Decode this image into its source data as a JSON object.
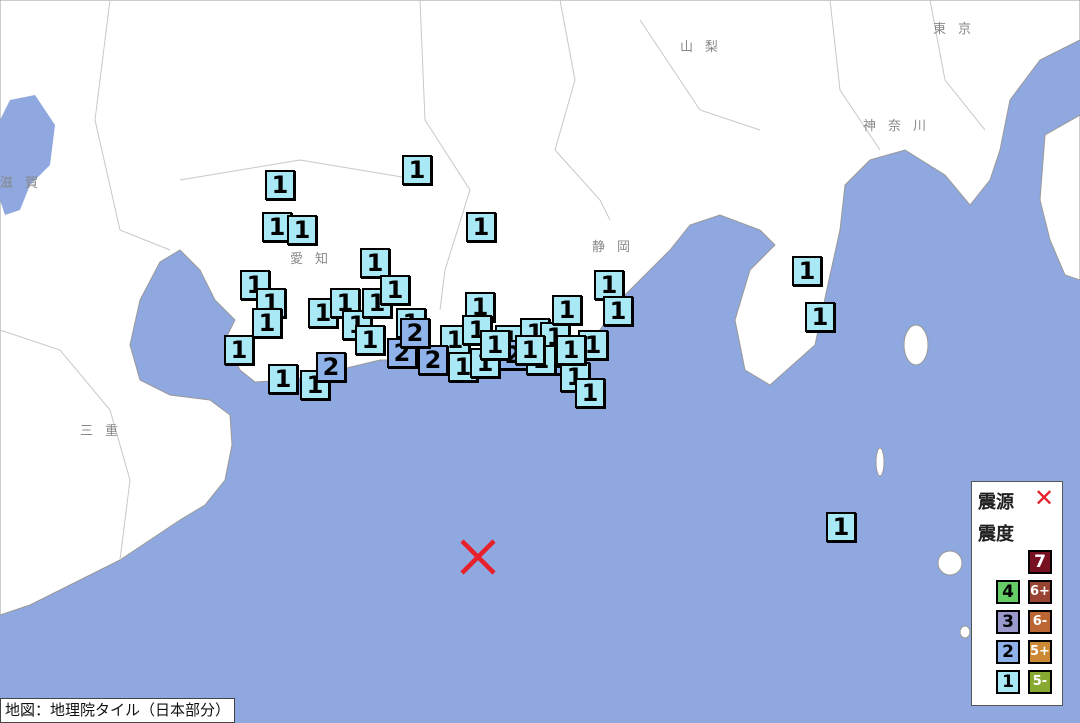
{
  "colors": {
    "sea": "#8fa8e0",
    "land": "#ffffff",
    "border": "#c8c8c8",
    "epicenter": "#e8202a",
    "intensity": {
      "1": "#a9e9f5",
      "2": "#8fb2ea",
      "3": "#9999cc",
      "4": "#66cc66",
      "5-": "#88aa33",
      "5+": "#cc8833",
      "6-": "#bb6633",
      "6+": "#994433",
      "7": "#771122"
    }
  },
  "prefectures": [
    {
      "name": "山梨"
    },
    {
      "name": "東京"
    },
    {
      "name": "神奈川"
    },
    {
      "name": "静岡"
    },
    {
      "name": "愛知"
    },
    {
      "name": "三重"
    },
    {
      "name": "滋賀"
    }
  ],
  "markers": [
    "1",
    "1",
    "1",
    "1",
    "1",
    "1",
    "1",
    "1",
    "1",
    "1",
    "1",
    "1",
    "1",
    "1",
    "1",
    "1",
    "1",
    "1",
    "1",
    "2",
    "1",
    "1",
    "1",
    "1",
    "1",
    "1",
    "1",
    "1",
    "1",
    "2",
    "2",
    "2",
    "2",
    "1",
    "1",
    "1",
    "1",
    "1",
    "1",
    "1",
    "1",
    "1",
    "2",
    "1",
    "1",
    "1"
  ],
  "legend": {
    "epicenter_label": "震源",
    "epicenter_symbol": "✕",
    "intensity_label": "震度",
    "levels": [
      {
        "level": "7"
      },
      {
        "level": "4"
      },
      {
        "level": "6+"
      },
      {
        "level": "3"
      },
      {
        "level": "6-"
      },
      {
        "level": "2"
      },
      {
        "level": "5+"
      },
      {
        "level": "1"
      },
      {
        "level": "5-"
      }
    ]
  },
  "credit": "地図：地理院タイル（日本部分）"
}
